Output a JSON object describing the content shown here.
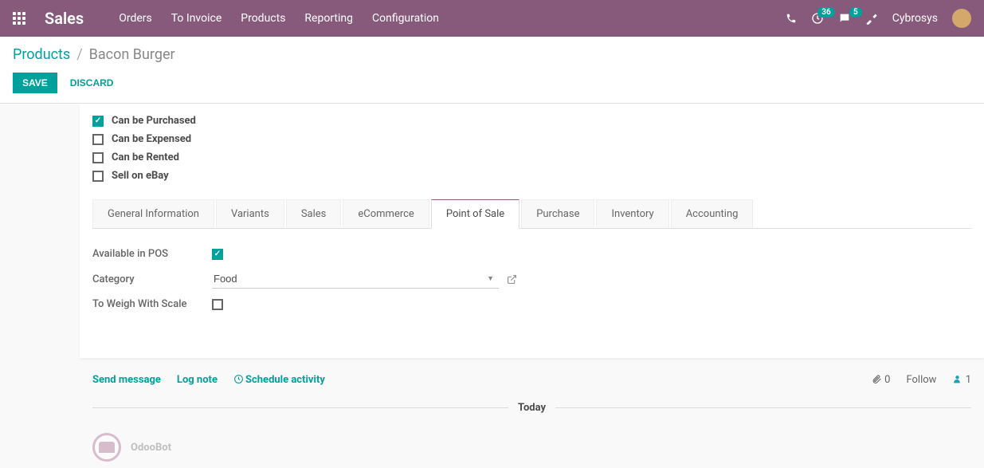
{
  "navbar": {
    "brand": "Sales",
    "menu": [
      "Orders",
      "To Invoice",
      "Products",
      "Reporting",
      "Configuration"
    ],
    "badge_clock": "36",
    "badge_chat": "5",
    "username": "Cybrosys"
  },
  "breadcrumb": {
    "root": "Products",
    "current": "Bacon Burger"
  },
  "actions": {
    "save": "SAVE",
    "discard": "DISCARD"
  },
  "checkboxes": [
    {
      "label": "Can be Purchased",
      "checked": true
    },
    {
      "label": "Can be Expensed",
      "checked": false
    },
    {
      "label": "Can be Rented",
      "checked": false
    },
    {
      "label": "Sell on eBay",
      "checked": false
    }
  ],
  "tabs": [
    "General Information",
    "Variants",
    "Sales",
    "eCommerce",
    "Point of Sale",
    "Purchase",
    "Inventory",
    "Accounting"
  ],
  "active_tab_index": 4,
  "pos_fields": {
    "available_label": "Available in POS",
    "available_checked": true,
    "category_label": "Category",
    "category_value": "Food",
    "weigh_label": "To Weigh With Scale",
    "weigh_checked": false
  },
  "chatter": {
    "send": "Send message",
    "lognote": "Log note",
    "schedule": "Schedule activity",
    "attach_count": "0",
    "follow": "Follow",
    "follower_count": "1",
    "timeline_label": "Today",
    "msg_author": "OdooBot",
    "msg_time": ""
  }
}
